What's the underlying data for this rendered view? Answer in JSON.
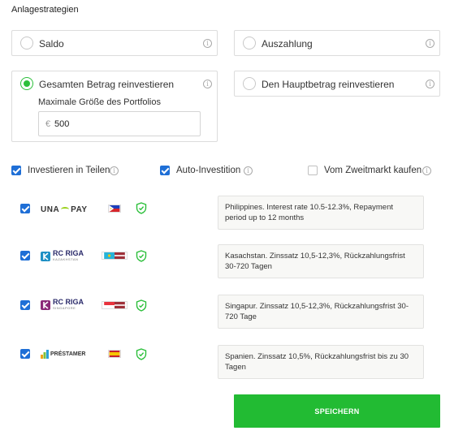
{
  "section_title": "Anlagestrategien",
  "options": {
    "saldo": {
      "label": "Saldo",
      "selected": false
    },
    "auszahlung": {
      "label": "Auszahlung",
      "selected": false
    },
    "reinvest_all": {
      "label": "Gesamten Betrag reinvestieren",
      "selected": true
    },
    "reinvest_principal": {
      "label": "Den Hauptbetrag reinvestieren",
      "selected": false
    }
  },
  "portfolio": {
    "label": "Maximale Größe des Portfolios",
    "currency": "€",
    "value": "500"
  },
  "checkboxes": {
    "invest_parts": {
      "label": "Investieren in Teilen",
      "checked": true
    },
    "auto_invest": {
      "label": "Auto-Investition",
      "checked": true
    },
    "secondary_market": {
      "label": "Vom Zweitmarkt kaufen",
      "checked": false
    }
  },
  "lenders": [
    {
      "logo_parts": [
        "UNA",
        "PAY"
      ],
      "logo_sub": "",
      "flag": "philippines",
      "checked": true,
      "description": "Philippines. Interest rate 10.5-12.3%, Repayment period up to 12 months"
    },
    {
      "logo_parts": [
        "RC RIGA"
      ],
      "logo_sub": "KAZAKHSTAN",
      "flag": "kazakhstan-latvia",
      "checked": true,
      "description": "Kasachstan. Zinssatz 10,5-12,3%, Rückzahlungsfrist 30-720 Tagen"
    },
    {
      "logo_parts": [
        "RC RIGA"
      ],
      "logo_sub": "SINGAPORE",
      "flag": "singapore-latvia",
      "checked": true,
      "description": "Singapur. Zinssatz 10,5-12,3%, Rückzahlungsfrist 30-720 Tage"
    },
    {
      "logo_parts": [
        "PRÉSTAMER"
      ],
      "logo_sub": "",
      "flag": "spain",
      "checked": true,
      "description": "Spanien. Zinssatz 10,5%, Rückzahlungsfrist bis zu 30 Tagen"
    }
  ],
  "info_glyph": "i",
  "save_label": "SPEICHERN",
  "colors": {
    "accent_green": "#22bb33",
    "checkbox_blue": "#1f6fd6",
    "shield_green": "#2bbf3a"
  }
}
